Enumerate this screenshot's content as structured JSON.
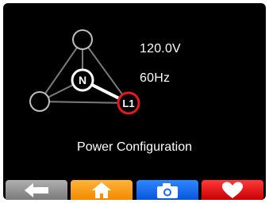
{
  "screen": {
    "title": "Power Configuration",
    "voltage": "120.0V",
    "frequency": "60Hz"
  },
  "diagram": {
    "neutral_label": "N",
    "line_label": "L1",
    "neutral_color": "#ffffff",
    "line_color": "#e41b1b",
    "inactive_node_color": "#bdbdbd",
    "active_wire_color": "#ffffff",
    "inactive_wire_color": "#7a7a7a"
  },
  "toolbar": {
    "buttons": [
      {
        "name": "back",
        "icon": "arrow-left-icon",
        "color": "#9a9a9a"
      },
      {
        "name": "home",
        "icon": "house-icon",
        "color": "#f7a21b"
      },
      {
        "name": "camera",
        "icon": "camera-icon",
        "color": "#1a66f0"
      },
      {
        "name": "favorite",
        "icon": "heart-icon",
        "color": "#e01010"
      }
    ]
  }
}
